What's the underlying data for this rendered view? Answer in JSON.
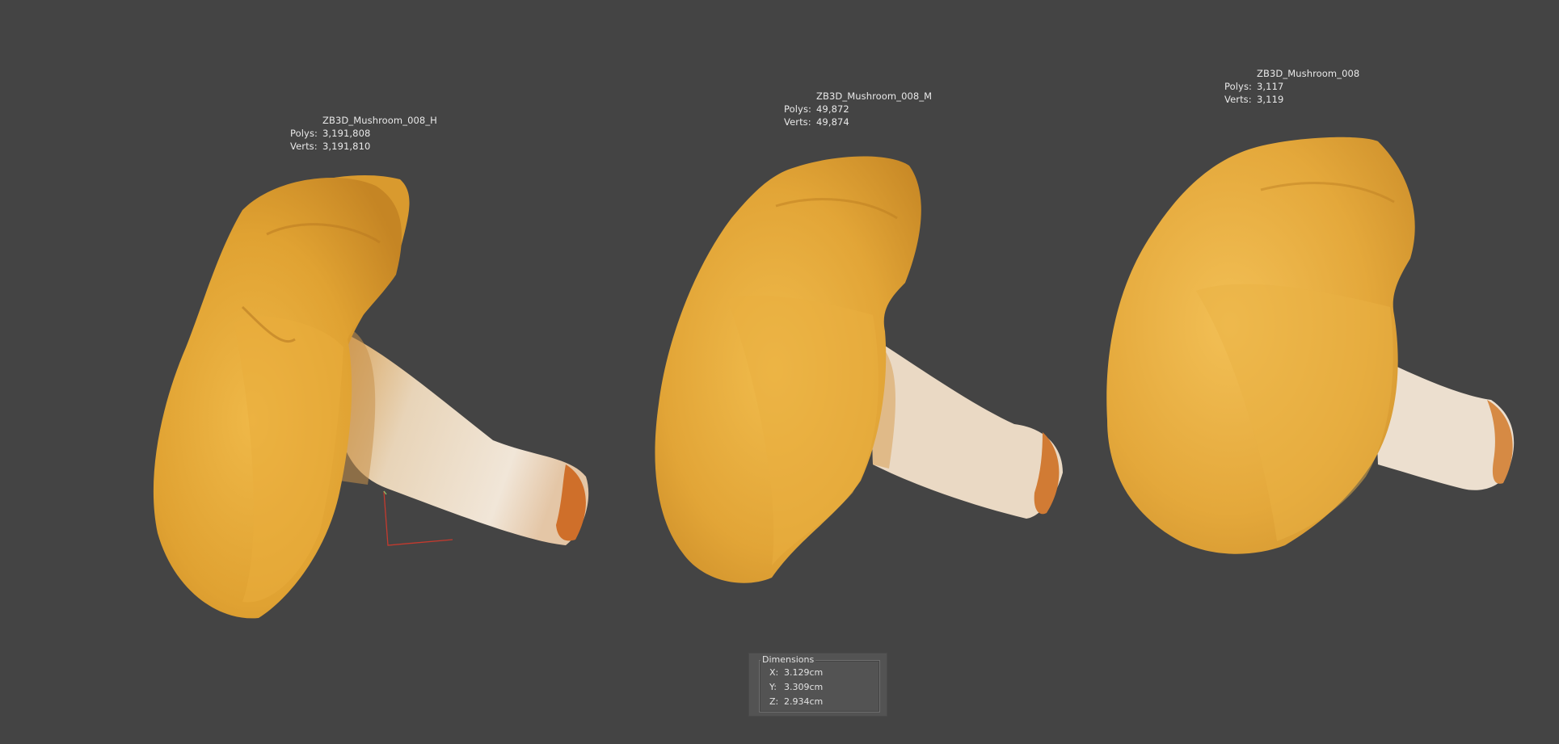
{
  "viewport": {
    "background": "#444444"
  },
  "models": [
    {
      "name": "ZB3D_Mushroom_008_H",
      "polys_label": "Polys:",
      "polys": "3,191,808",
      "verts_label": "Verts:",
      "verts": "3,191,810"
    },
    {
      "name": "ZB3D_Mushroom_008_M",
      "polys_label": "Polys:",
      "polys": "49,872",
      "verts_label": "Verts:",
      "verts": "49,874"
    },
    {
      "name": "ZB3D_Mushroom_008",
      "polys_label": "Polys:",
      "polys": "3,117",
      "verts_label": "Verts:",
      "verts": "3,119"
    }
  ],
  "dimensions": {
    "title": "Dimensions",
    "x_label": "X:",
    "x": "3.129cm",
    "y_label": "Y:",
    "y": "3.309cm",
    "z_label": "Z:",
    "z": "2.934cm"
  },
  "colors": {
    "cap": "#e3a638",
    "cap_shadow": "#b77a1f",
    "stem": "#eadccb",
    "stem_tip": "#d2742e"
  }
}
